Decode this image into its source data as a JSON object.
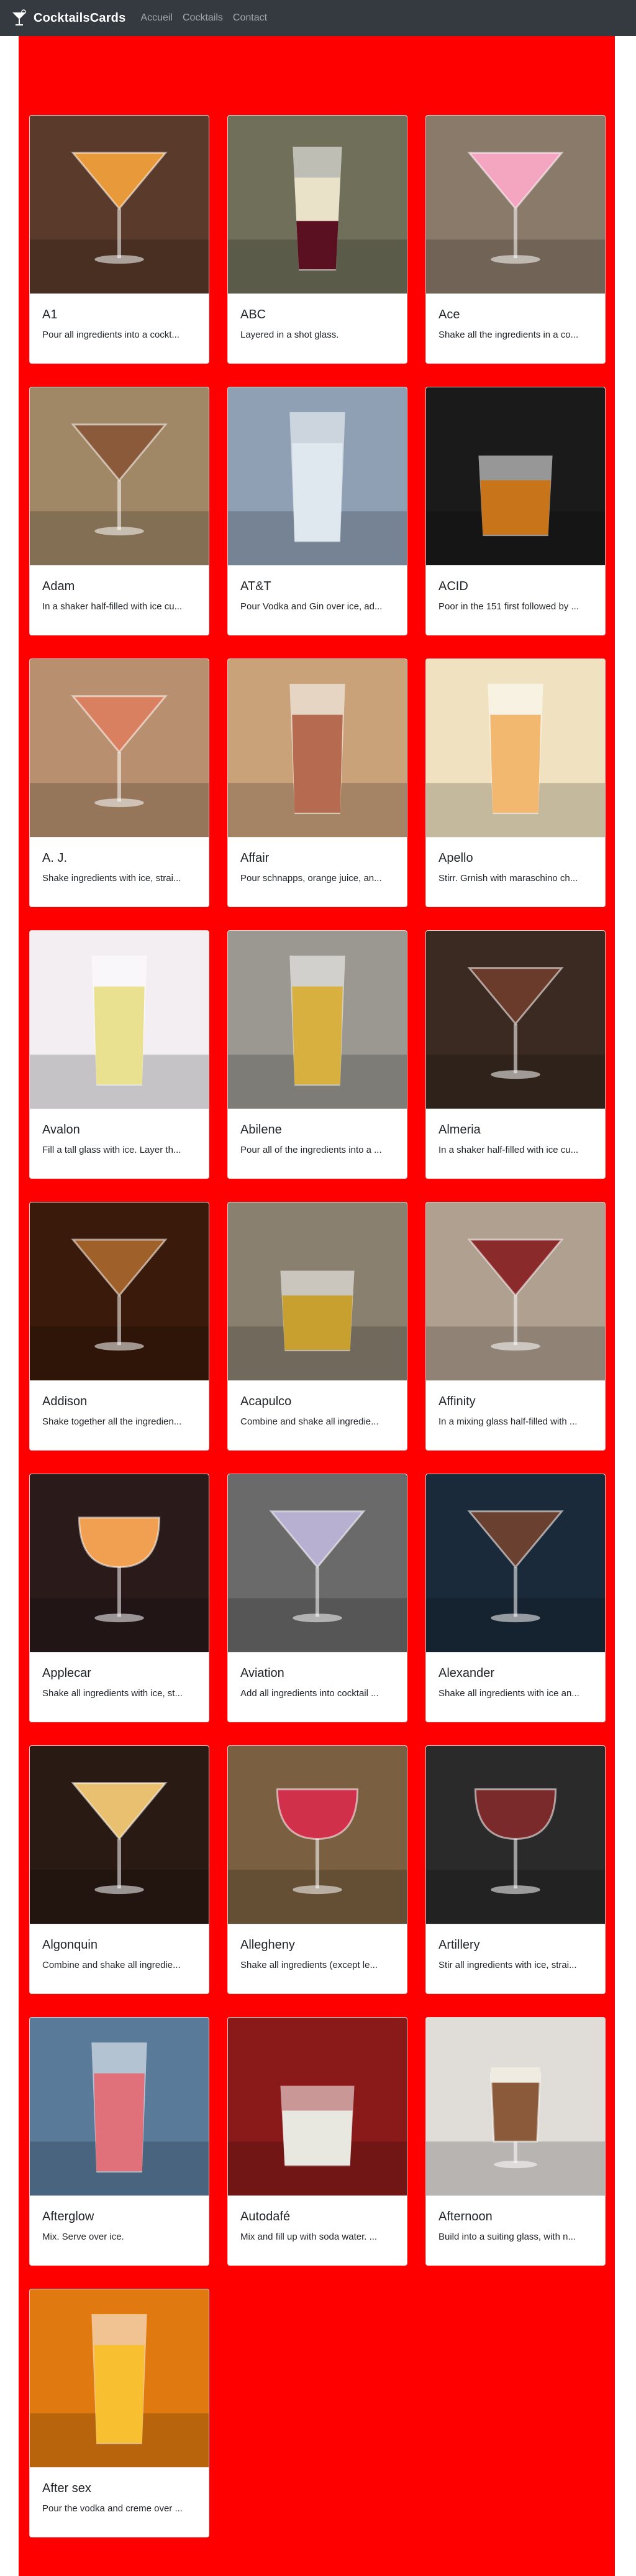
{
  "app": {
    "brand": "CocktailsCards",
    "logo_icon": "cocktail-logo-icon",
    "nav": [
      "Accueil",
      "Cocktails",
      "Contact"
    ]
  },
  "colors": {
    "navbar_bg": "#343a40",
    "page_bg": "#ff0000",
    "card_bg": "#ffffff"
  },
  "cocktails": [
    {
      "name": "A1",
      "description": "Pour all ingredients into a cockt...",
      "glass_icon": "martini-glass-icon",
      "drink_color": "#e89a3a",
      "bg_color": "#5a3a2a"
    },
    {
      "name": "ABC",
      "description": "Layered in a shot glass.",
      "glass_icon": "shot-glass-icon",
      "drink_color": "#e9e2c8",
      "bg_color": "#6f6f5a"
    },
    {
      "name": "Ace",
      "description": "Shake all the ingredients in a co...",
      "glass_icon": "martini-glass-icon",
      "drink_color": "#f4a6c0",
      "bg_color": "#8a7a6a"
    },
    {
      "name": "Adam",
      "description": "In a shaker half-filled with ice cu...",
      "glass_icon": "martini-glass-icon",
      "drink_color": "#8a5a3a",
      "bg_color": "#a08866"
    },
    {
      "name": "AT&T",
      "description": "Pour Vodka and Gin over ice, ad...",
      "glass_icon": "highball-glass-icon",
      "drink_color": "#dfe8ee",
      "bg_color": "#8fa0b5"
    },
    {
      "name": "ACID",
      "description": "Poor in the 151 first followed by ...",
      "glass_icon": "rocks-glass-icon",
      "drink_color": "#c8741a",
      "bg_color": "#1a1a1a"
    },
    {
      "name": "A. J.",
      "description": "Shake ingredients with ice, strai...",
      "glass_icon": "martini-glass-icon",
      "drink_color": "#d98060",
      "bg_color": "#b89070"
    },
    {
      "name": "Affair",
      "description": "Pour schnapps, orange juice, an...",
      "glass_icon": "highball-glass-icon",
      "drink_color": "#b66a50",
      "bg_color": "#c9a27a"
    },
    {
      "name": "Apello",
      "description": "Stirr. Grnish with maraschino ch...",
      "glass_icon": "highball-glass-icon",
      "drink_color": "#f2b870",
      "bg_color": "#f0e2c0"
    },
    {
      "name": "Avalon",
      "description": "Fill a tall glass with ice. Layer th...",
      "glass_icon": "highball-glass-icon",
      "drink_color": "#e9e090",
      "bg_color": "#f2eef2"
    },
    {
      "name": "Abilene",
      "description": "Pour all of the ingredients into a ...",
      "glass_icon": "highball-glass-icon",
      "drink_color": "#d8b040",
      "bg_color": "#9a9890"
    },
    {
      "name": "Almeria",
      "description": "In a shaker half-filled with ice cu...",
      "glass_icon": "martini-glass-icon",
      "drink_color": "#6a3a2a",
      "bg_color": "#3a2a22"
    },
    {
      "name": "Addison",
      "description": "Shake together all the ingredien...",
      "glass_icon": "martini-glass-icon",
      "drink_color": "#a0602a",
      "bg_color": "#3a1a0a"
    },
    {
      "name": "Acapulco",
      "description": "Combine and shake all ingredie...",
      "glass_icon": "rocks-glass-icon",
      "drink_color": "#c8a030",
      "bg_color": "#8a8070"
    },
    {
      "name": "Affinity",
      "description": "In a mixing glass half-filled with ...",
      "glass_icon": "martini-glass-icon",
      "drink_color": "#8a2a2a",
      "bg_color": "#b0a090"
    },
    {
      "name": "Applecar",
      "description": "Shake all ingredients with ice, st...",
      "glass_icon": "coupe-glass-icon",
      "drink_color": "#f0a050",
      "bg_color": "#2a1a1a"
    },
    {
      "name": "Aviation",
      "description": "Add all ingredients into cocktail ...",
      "glass_icon": "martini-glass-icon",
      "drink_color": "#b8b0d0",
      "bg_color": "#6a6a6a"
    },
    {
      "name": "Alexander",
      "description": "Shake all ingredients with ice an...",
      "glass_icon": "martini-glass-icon",
      "drink_color": "#6a4030",
      "bg_color": "#1a2a3a"
    },
    {
      "name": "Algonquin",
      "description": "Combine and shake all ingredie...",
      "glass_icon": "martini-glass-icon",
      "drink_color": "#e8c070",
      "bg_color": "#2a1a14"
    },
    {
      "name": "Allegheny",
      "description": "Shake all ingredients (except le...",
      "glass_icon": "coupe-glass-icon",
      "drink_color": "#d0304a",
      "bg_color": "#7a6040"
    },
    {
      "name": "Artillery",
      "description": "Stir all ingredients with ice, strai...",
      "glass_icon": "coupe-glass-icon",
      "drink_color": "#7a2a2a",
      "bg_color": "#2a2a2a"
    },
    {
      "name": "Afterglow",
      "description": "Mix. Serve over ice.",
      "glass_icon": "highball-glass-icon",
      "drink_color": "#e0707a",
      "bg_color": "#5a7a9a"
    },
    {
      "name": "Autodafé",
      "description": "Mix and fill up with soda water. ...",
      "glass_icon": "rocks-glass-icon",
      "drink_color": "#e8e8e0",
      "bg_color": "#8a1a1a"
    },
    {
      "name": "Afternoon",
      "description": "Build into a suiting glass, with n...",
      "glass_icon": "irish-coffee-glass-icon",
      "drink_color": "#8a5a3a",
      "bg_color": "#e0dcd8"
    },
    {
      "name": "After sex",
      "description": "Pour the vodka and creme over ...",
      "glass_icon": "highball-glass-icon",
      "drink_color": "#f8c030",
      "bg_color": "#e07a10"
    }
  ]
}
